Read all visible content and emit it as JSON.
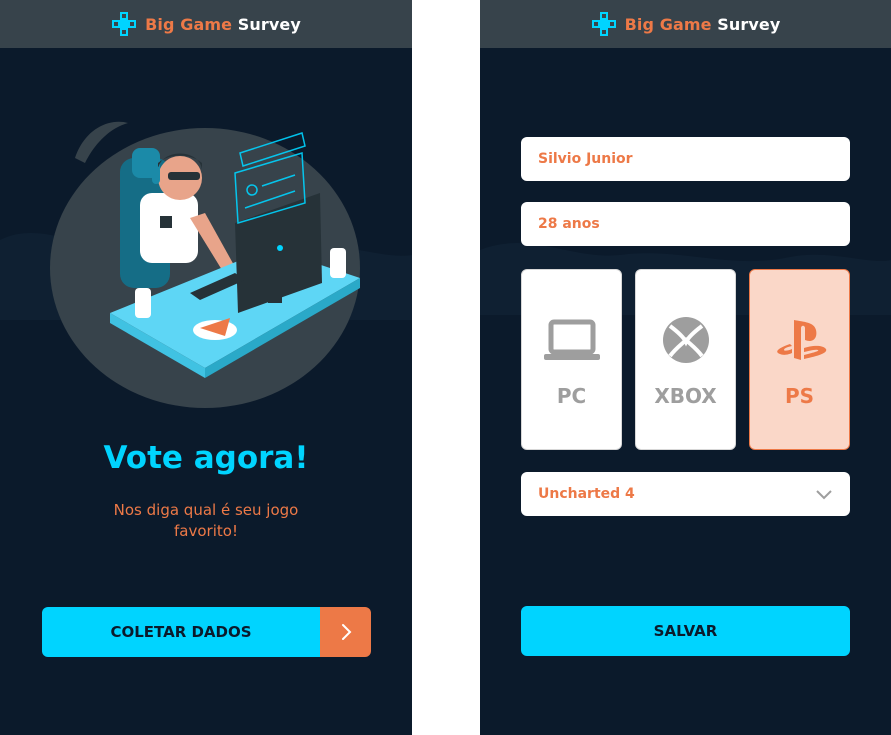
{
  "colors": {
    "background": "#0b1a2b",
    "header": "#37434b",
    "accent_blue": "#00d4ff",
    "accent_orange": "#ed7947",
    "selected_platform_bg": "#fad7c8"
  },
  "left_screen": {
    "header": {
      "brand_primary": "Big Game",
      "brand_secondary": "Survey",
      "logo_icon": "gamepad-cross-icon"
    },
    "title": "Vote agora!",
    "subtitle": "Nos diga qual é seu jogo favorito!",
    "cta_label": "COLETAR DADOS",
    "cta_icon": "chevron-right-icon"
  },
  "right_screen": {
    "header": {
      "brand_primary": "Big Game",
      "brand_secondary": "Survey",
      "logo_icon": "gamepad-cross-icon"
    },
    "name_field": {
      "value": "Silvio Junior"
    },
    "age_field": {
      "value": "28 anos"
    },
    "platforms": [
      {
        "label": "PC",
        "icon": "laptop-icon",
        "selected": false
      },
      {
        "label": "XBOX",
        "icon": "xbox-icon",
        "selected": false
      },
      {
        "label": "PS",
        "icon": "playstation-icon",
        "selected": true
      }
    ],
    "game_select": {
      "value": "Uncharted 4",
      "icon": "chevron-down-icon"
    },
    "save_label": "SALVAR"
  }
}
